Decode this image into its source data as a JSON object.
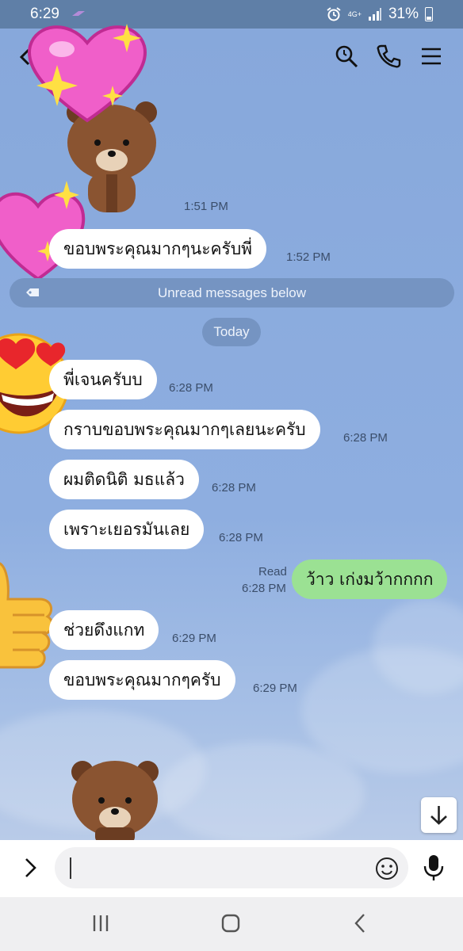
{
  "status_bar": {
    "time": "6:29",
    "network": "4G+",
    "battery": "31%"
  },
  "header": {
    "icons": [
      "back-icon",
      "search-icon",
      "phone-icon",
      "menu-icon"
    ]
  },
  "messages": {
    "m1": {
      "text": "ขอบพระคุณมากๆนะครับพี่",
      "time": "1:52 PM"
    },
    "m2": {
      "text": "พี่เจนครับบ",
      "time": "6:28 PM"
    },
    "m3": {
      "text": "กราบขอบพระคุณมากๆเลยนะครับ",
      "time": "6:28 PM"
    },
    "m4": {
      "text": "ผมติดนิติ มธแล้ว",
      "time": "6:28 PM"
    },
    "m5": {
      "text": "เพราะเยอรมันเลย",
      "time": "6:28 PM"
    },
    "m6": {
      "text": "ว้าว เก่งมว้ากกกก",
      "time": "6:28 PM",
      "read": "Read"
    },
    "m7": {
      "text": "ช่วยดึงแกท",
      "time": "6:29 PM"
    },
    "m8": {
      "text": "ขอบพระคุณมากๆครับ",
      "time": "6:29 PM"
    }
  },
  "sticker_time": "1:51 PM",
  "unread_label": "Unread messages below",
  "today_label": "Today",
  "input": {
    "value": "",
    "placeholder": ""
  },
  "colors": {
    "chat_bg": "#8daedd",
    "incoming_bubble": "#ffffff",
    "outgoing_bubble": "#9be193",
    "status_bar": "#5f7fa7"
  }
}
